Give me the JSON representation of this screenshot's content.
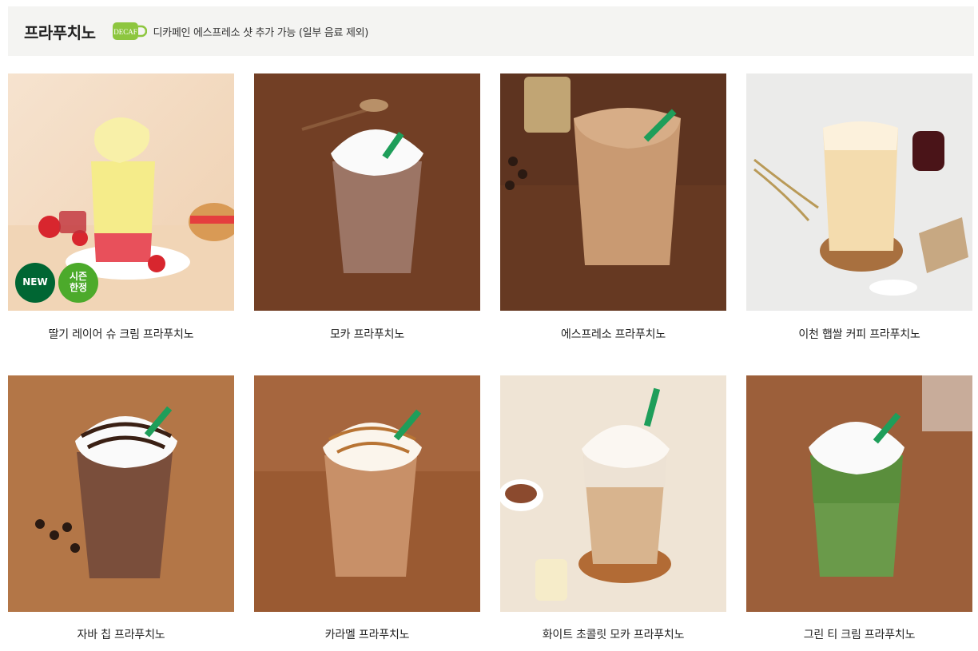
{
  "header": {
    "title": "프라푸치노",
    "decaf_icon": "decaf-cup-icon",
    "decaf_label": "DECAF",
    "decaf_note": "디카페인 에스프레소 샷 추가 가능 (일부 음료 제외)"
  },
  "badges": {
    "new": "NEW",
    "season_line1": "시즌",
    "season_line2": "한정"
  },
  "products": [
    {
      "name": "딸기 레이어 슈 크림 프라푸치노"
    },
    {
      "name": "모카 프라푸치노"
    },
    {
      "name": "에스프레소 프라푸치노"
    },
    {
      "name": "이천 햅쌀 커피 프라푸치노"
    },
    {
      "name": "자바 칩 프라푸치노"
    },
    {
      "name": "카라멜 프라푸치노"
    },
    {
      "name": "화이트 초콜릿 모카 프라푸치노"
    },
    {
      "name": "그린 티 크림 프라푸치노"
    }
  ],
  "colors": {
    "header_bg": "#f4f4f2",
    "new_badge": "#006633",
    "season_badge": "#4caa2b",
    "decaf": "#8dc63f"
  }
}
